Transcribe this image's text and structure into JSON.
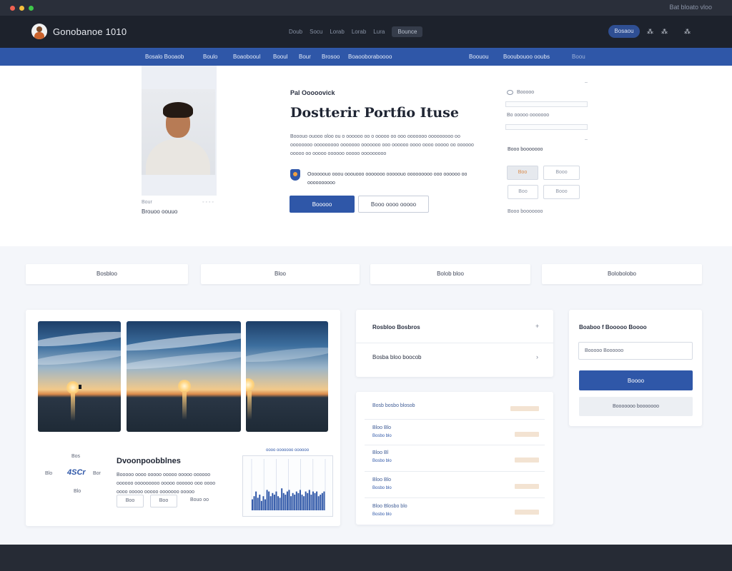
{
  "window": {
    "title": "Bat bloato vloo"
  },
  "header": {
    "brand": "Gonobanoe 1010",
    "links": [
      "Doub",
      "Socu",
      "Lorab",
      "Lorab",
      "Lura"
    ],
    "active_link": "Bounce",
    "cta": "Bosaou",
    "icons": [
      "grid-icon",
      "user-icon",
      "bell-icon"
    ],
    "icon_glyphs": [
      "⁂",
      "⁂",
      "⁂"
    ]
  },
  "nav": {
    "items": [
      "Bosalo Booaob",
      "Boulo",
      "Boaobooul",
      "Booul",
      "Bour",
      "Brosoo",
      "Boaooboraboooo",
      "Boouou",
      "Booubouoo ooubs",
      "Boou"
    ]
  },
  "hero": {
    "photo_caption": "Bour",
    "photo_name": "Brouoo oouuo",
    "photo_meta": "◦ ◦ ◦ ◦",
    "eyebrow": "Pal Ooooovick",
    "title": "Dostterir Portfio Ituse",
    "description": "Booouo ouooo oloo ou o oooooo oo o ooooo oo ooo ooooooo ooooooooo oo oooooooo ooooooooo ooooooo ooooooo ooo oooooo oooo oooo ooooo oo oooooo ooooo oo ooooo oooooo ooooo ooooooooo",
    "feature": "Oooooouo ooou ooouooo ooooooo ooooouo ooooooooo ooo oooooo oo oooooooooo",
    "primary_button": "Booooo",
    "secondary_button": "Booo oooo ooooo"
  },
  "aside": {
    "search_label": "Booooo",
    "filter_label": "Bo ooooo ooooooo",
    "tags_heading": "Booo booooooo",
    "tags": [
      "Boo",
      "Booo",
      "Boo",
      "Booo"
    ],
    "footer_label": "Booo booooooo"
  },
  "stats": [
    "Bosbloo",
    "Bloo",
    "Bolob bloo",
    "Bolobolobo"
  ],
  "gallery": {
    "side_labels": [
      "Bos",
      "Blo",
      "Bor",
      "Blo"
    ],
    "stat_value": "4SCr",
    "title": "Dvoonpoobblnes",
    "description": "Booooo oooo ooooo ooooo ooooo oooooo oooooo ooooooooo ooooo oooooo ooo oooo oooo ooooo ooooo ooooooo ooooo",
    "chips": [
      "Boo",
      "Boo",
      "Bouo oo"
    ],
    "chart_caption": "oooo ooooooo oooooo"
  },
  "chart_data": {
    "type": "bar",
    "values": [
      7,
      9,
      12,
      8,
      10,
      6,
      9,
      7,
      13,
      12,
      9,
      11,
      10,
      12,
      9,
      8,
      14,
      11,
      10,
      12,
      13,
      9,
      11,
      10,
      12,
      11,
      13,
      10,
      9,
      12,
      11,
      13,
      10,
      12,
      11,
      12,
      9,
      10,
      11,
      12
    ]
  },
  "accordion": {
    "items": [
      {
        "title": "Rosbloo Bosbros",
        "arrow": "+"
      },
      {
        "title": "Bosba bloo boocob",
        "arrow": "›"
      }
    ]
  },
  "list": {
    "heading": "Bosb bosbo blosob",
    "rows": [
      {
        "title": "Bloo Blo",
        "sub": "Bosbo blo"
      },
      {
        "title": "Bloo Bl",
        "sub": "Bosbo blo"
      },
      {
        "title": "Bloo Blo",
        "sub": "Bosbo blo"
      },
      {
        "title": "Bloo Blosbo blo",
        "sub": "Bosbo blo"
      }
    ]
  },
  "form": {
    "title": "Boaboo f Booooo Boooo",
    "placeholder": "Booooo Boooooo",
    "submit": "Boooo",
    "secondary": "Booooooo booooooo"
  },
  "colors": {
    "accent": "#2f57a8",
    "nav": "#2f57a8",
    "topbar": "#1d222c",
    "footer": "#262b35"
  }
}
